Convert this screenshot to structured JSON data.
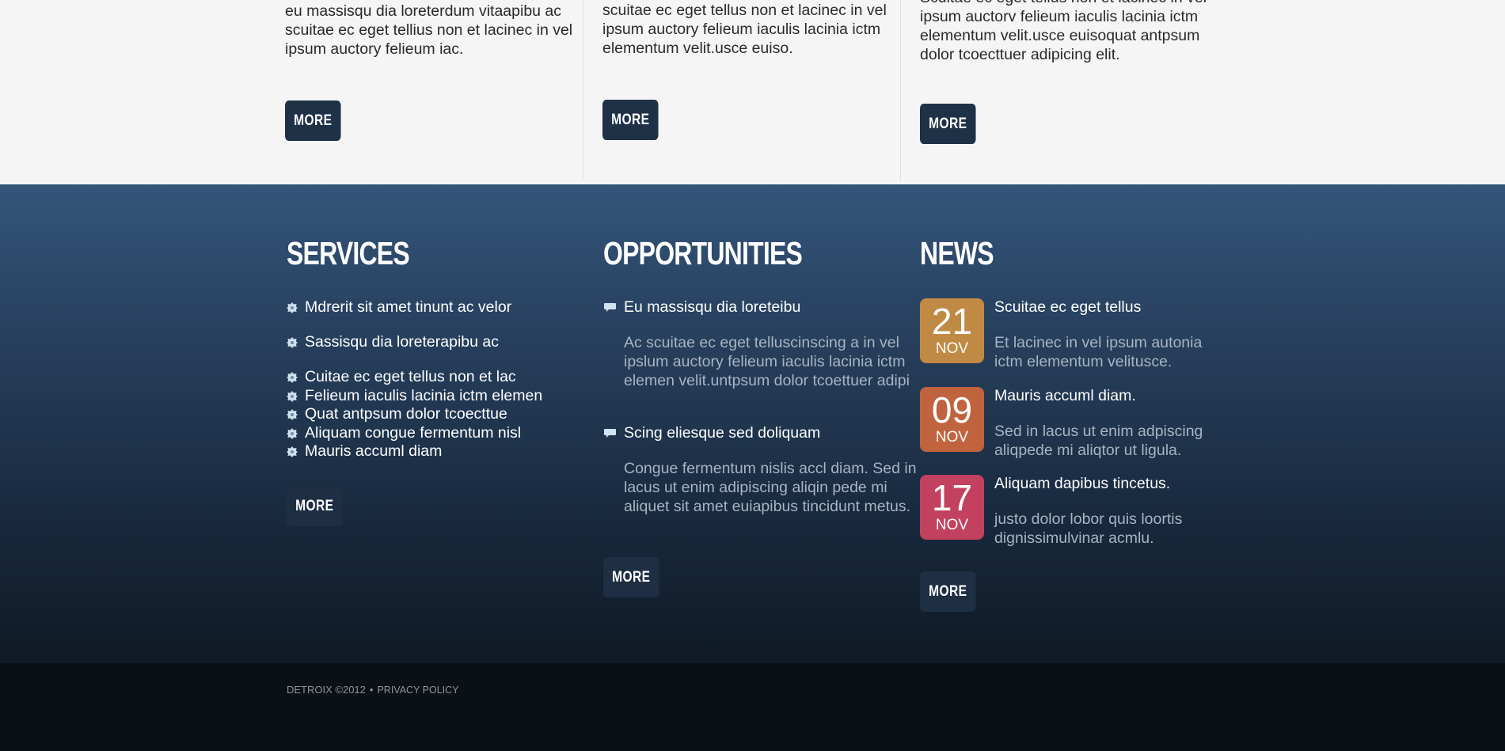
{
  "top_columns": [
    {
      "text": "eu massisqu dia loreterdum vitaapibu ac scuitae ec eget tellius non et lacinec in vel ipsum auctory felieum iac.",
      "more_label": "MORE"
    },
    {
      "text": "scuitae ec eget tellus non et lacinec in vel ipsum auctory felieum iaculis lacinia ictm elementum velit.usce euiso.",
      "more_label": "MORE"
    },
    {
      "text": "Scuitae ec eget tellus non et lacinec in vel ipsum auctorv felieum iaculis lacinia ictm elementum velit.usce euisoquat antpsum dolor tcoecttuer adipicing elit.",
      "more_label": "MORE"
    }
  ],
  "services": {
    "heading": "SERVICES",
    "items": [
      "Mdrerit sit amet tinunt ac velor",
      "Sassisqu dia loreterapibu ac",
      "Cuitae ec eget tellus non et lac",
      "Felieum iaculis lacinia ictm elemen",
      "Quat antpsum dolor tcoecttue",
      "Aliquam congue fermentum nisl",
      "Mauris accuml diam"
    ],
    "more_label": "MORE"
  },
  "opportunities": {
    "heading": "OPPORTUNITIES",
    "items": [
      {
        "title": "Eu massisqu dia loreteibu",
        "text": "Ac scuitae ec eget telluscinscing a in vel ipslum auctory felieum iaculis lacinia ictm elemen velit.untpsum dolor tcoettuer adipi"
      },
      {
        "title": "Scing eliesque sed doliquam",
        "text": "Congue fermentum nislis accl diam. Sed in lacus ut enim adipiscing aliqin pede mi aliquet sit amet euiapibus tincidunt metus."
      }
    ],
    "more_label": "MORE"
  },
  "news": {
    "heading": "NEWS",
    "items": [
      {
        "day": "21",
        "month": "NOV",
        "color": "#c08a45",
        "title": "Scuitae ec eget tellus",
        "text": "Et lacinec in vel ipsum autonia ictm elementum velitusce."
      },
      {
        "day": "09",
        "month": "NOV",
        "color": "#c0633f",
        "title": "Mauris accuml diam.",
        "text": "Sed in lacus ut enim adpiscing aliqpede mi aliqtor ut ligula."
      },
      {
        "day": "17",
        "month": "NOV",
        "color": "#c2415f",
        "title": "Aliquam dapibus tincetus.",
        "text": "justo dolor lobor quis loortis dignissimulvinar acmlu."
      }
    ],
    "more_label": "MORE"
  },
  "footer": {
    "copyright": "DETROIX ©2012",
    "separator": "•",
    "privacy_label": "PRIVACY POLICY"
  },
  "colors": {
    "button": "#1f3147",
    "top_bg": "#f5f5f5",
    "footer_bg": "#0a1015"
  }
}
